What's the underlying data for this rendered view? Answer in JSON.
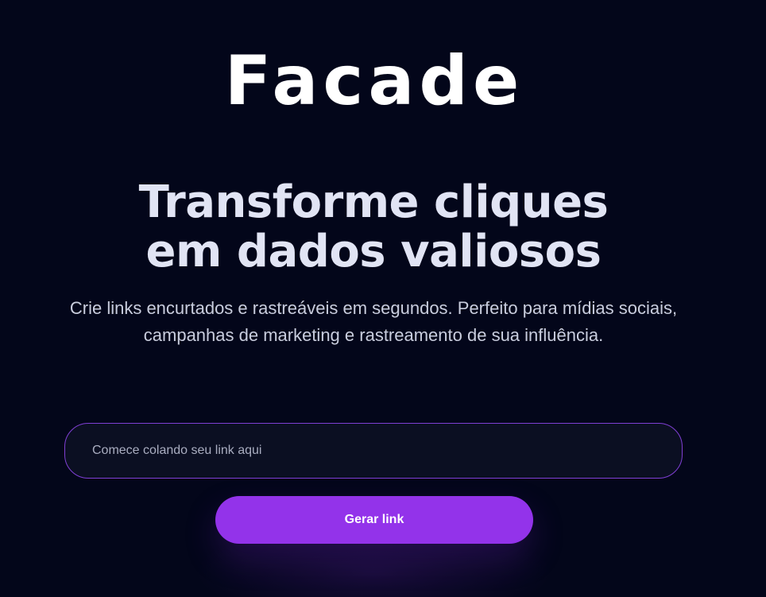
{
  "header": {
    "logo_text": "Facade"
  },
  "hero": {
    "headline": "Transforme cliques em dados valiosos",
    "subtitle": "Crie links encurtados e rastreáveis em segundos. Perfeito para mídias sociais, campanhas de marketing e rastreamento de sua influência."
  },
  "form": {
    "link_input": {
      "value": "",
      "placeholder": "Comece colando seu link aqui"
    },
    "submit_label": "Gerar link"
  },
  "colors": {
    "background": "#03061a",
    "accent": "#9333ea",
    "input_border": "#7f3fd4"
  }
}
